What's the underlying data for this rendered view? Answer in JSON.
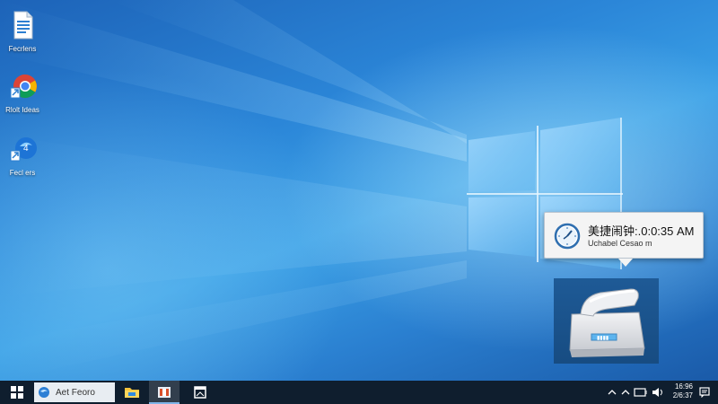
{
  "desktop": {
    "icons": [
      {
        "label": "Fecrlens",
        "icon": "document-icon"
      },
      {
        "label": "Rlolt Ideas",
        "icon": "chrome-icon"
      },
      {
        "label": "Fecl ers",
        "icon": "edge-icon"
      }
    ]
  },
  "notification": {
    "icon": "clock-icon",
    "title": "美捷闹钟:.0:0:35 AM",
    "subtitle": "Uchabel Cesao m"
  },
  "device_panel": {
    "icon": "device-icon"
  },
  "taskbar": {
    "search_text": "Aet Feoro",
    "tray_time": "16:96",
    "tray_date": "2/6:37",
    "accent": "#7fb4e8"
  }
}
